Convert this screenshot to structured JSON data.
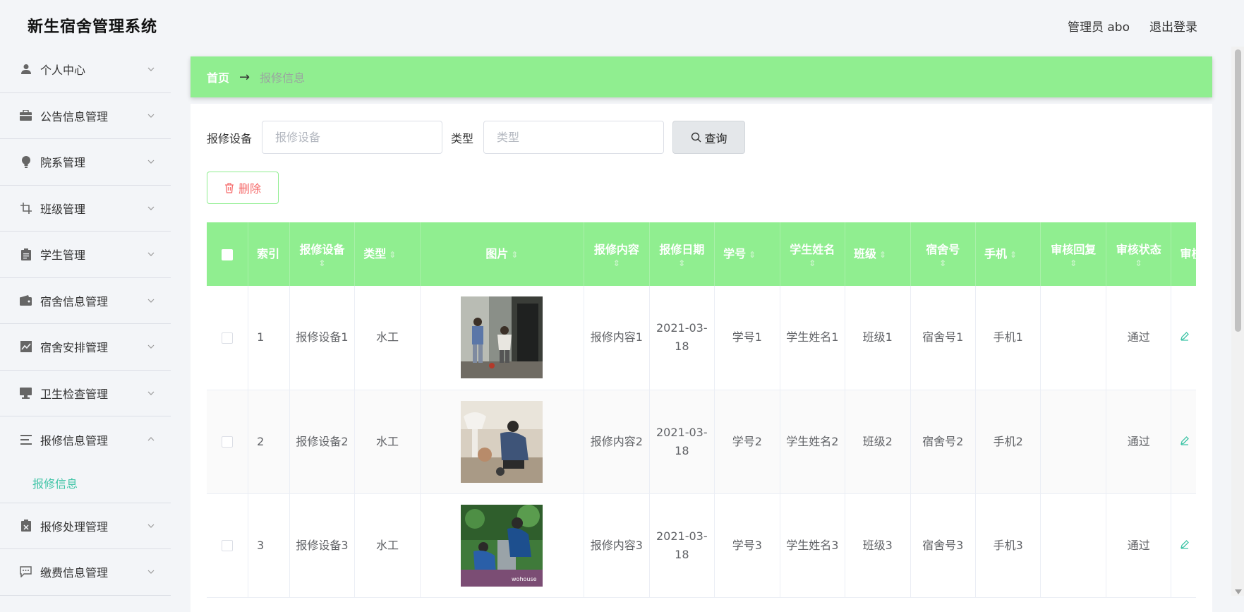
{
  "header": {
    "app_title": "新生宿舍管理系统",
    "user_label": "管理员 abo",
    "logout_label": "退出登录"
  },
  "sidebar": {
    "items": [
      {
        "label": "个人中心",
        "icon": "user-icon"
      },
      {
        "label": "公告信息管理",
        "icon": "briefcase-icon"
      },
      {
        "label": "院系管理",
        "icon": "lightbulb-icon"
      },
      {
        "label": "班级管理",
        "icon": "crop-icon"
      },
      {
        "label": "学生管理",
        "icon": "clipboard-icon"
      },
      {
        "label": "宿舍信息管理",
        "icon": "wallet-icon"
      },
      {
        "label": "宿舍安排管理",
        "icon": "chart-icon"
      },
      {
        "label": "卫生检查管理",
        "icon": "monitor-icon"
      },
      {
        "label": "报修信息管理",
        "icon": "list-icon",
        "expanded": true
      },
      {
        "label": "报修处理管理",
        "icon": "document-x-icon"
      },
      {
        "label": "缴费信息管理",
        "icon": "chat-icon"
      }
    ],
    "active_sub_label": "报修信息"
  },
  "breadcrumb": {
    "home": "首页",
    "arrow": "→",
    "current": "报修信息"
  },
  "search": {
    "device_label": "报修设备",
    "device_placeholder": "报修设备",
    "type_label": "类型",
    "type_placeholder": "类型",
    "query_label": "查询"
  },
  "actions": {
    "delete_label": "删除"
  },
  "table": {
    "headers": {
      "index": "索引",
      "device": "报修设备",
      "type": "类型",
      "image": "图片",
      "content": "报修内容",
      "date": "报修日期",
      "student_no": "学号",
      "student_name": "学生姓名",
      "class": "班级",
      "dorm": "宿舍号",
      "phone": "手机",
      "reply": "审核回复",
      "status": "审核状态",
      "review": "审核"
    },
    "rows": [
      {
        "index": "1",
        "device": "报修设备1",
        "type": "水工",
        "content": "报修内容1",
        "date": "2021-03-18",
        "student_no": "学号1",
        "student_name": "学生姓名1",
        "class": "班级1",
        "dorm": "宿舍号1",
        "phone": "手机1",
        "reply": "",
        "status": "通过"
      },
      {
        "index": "2",
        "device": "报修设备2",
        "type": "水工",
        "content": "报修内容2",
        "date": "2021-03-18",
        "student_no": "学号2",
        "student_name": "学生姓名2",
        "class": "班级2",
        "dorm": "宿舍号2",
        "phone": "手机2",
        "reply": "",
        "status": "通过"
      },
      {
        "index": "3",
        "device": "报修设备3",
        "type": "水工",
        "content": "报修内容3",
        "date": "2021-03-18",
        "student_no": "学号3",
        "student_name": "学生姓名3",
        "class": "班级3",
        "dorm": "宿舍号3",
        "phone": "手机3",
        "reply": "",
        "status": "通过"
      }
    ]
  },
  "colors": {
    "accent_green": "#90ee90",
    "active_teal": "#3fc4a6",
    "danger_red": "#f56c6c"
  }
}
